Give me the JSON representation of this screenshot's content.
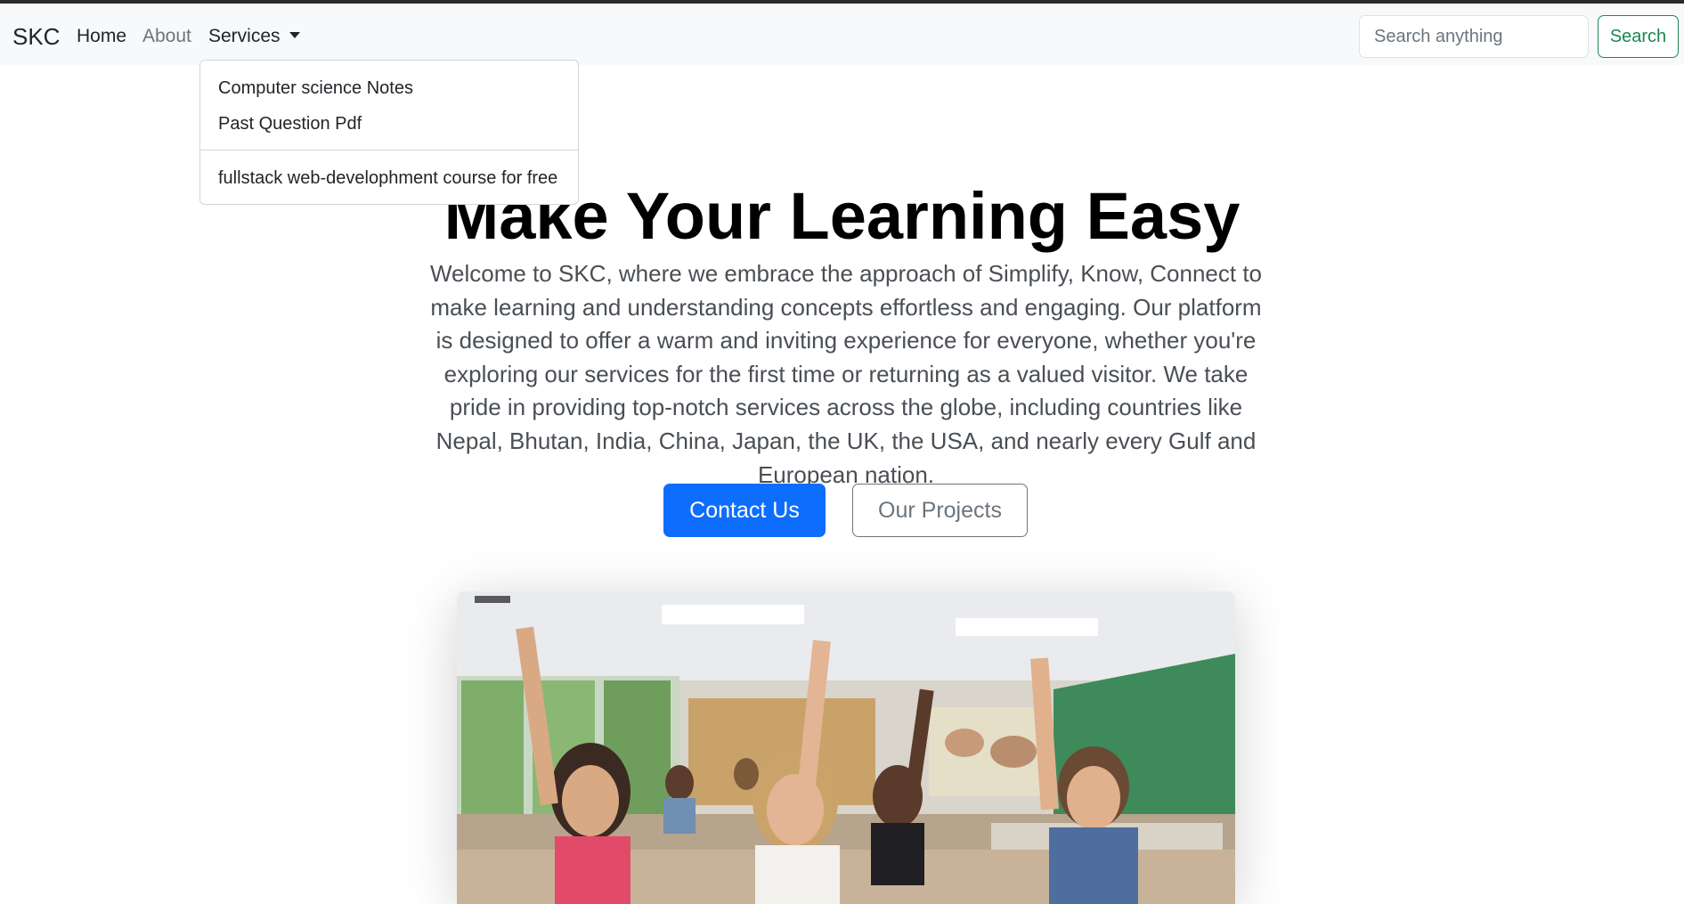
{
  "navbar": {
    "brand": "SKC",
    "links": {
      "home": "Home",
      "about": "About",
      "services": "Services"
    },
    "search": {
      "placeholder": "Search anything",
      "button_label": "Search"
    }
  },
  "dropdown": {
    "items": [
      "Computer science Notes",
      "Past Question Pdf",
      "fullstack web-develophment course for free"
    ]
  },
  "hero": {
    "title": "Make Your Learning Easy",
    "description": "Welcome to SKC, where we embrace the approach of Simplify, Know, Connect to make learning and understanding concepts effortless and engaging. Our platform is designed to offer a warm and inviting experience for everyone, whether you're exploring our services for the first time or returning as a valued visitor. We take pride in providing top-notch services across the globe, including countries like Nepal, Bhutan, India, China, Japan, the UK, the USA, and nearly every Gulf and European nation.",
    "primary_button": "Contact Us",
    "secondary_button": "Our Projects"
  },
  "colors": {
    "primary": "#0d6efd",
    "success": "#198754",
    "secondary": "#6c757d",
    "navbar_bg": "#f8f9fa"
  },
  "icons": {
    "services_toggle": "caret-down-icon"
  }
}
